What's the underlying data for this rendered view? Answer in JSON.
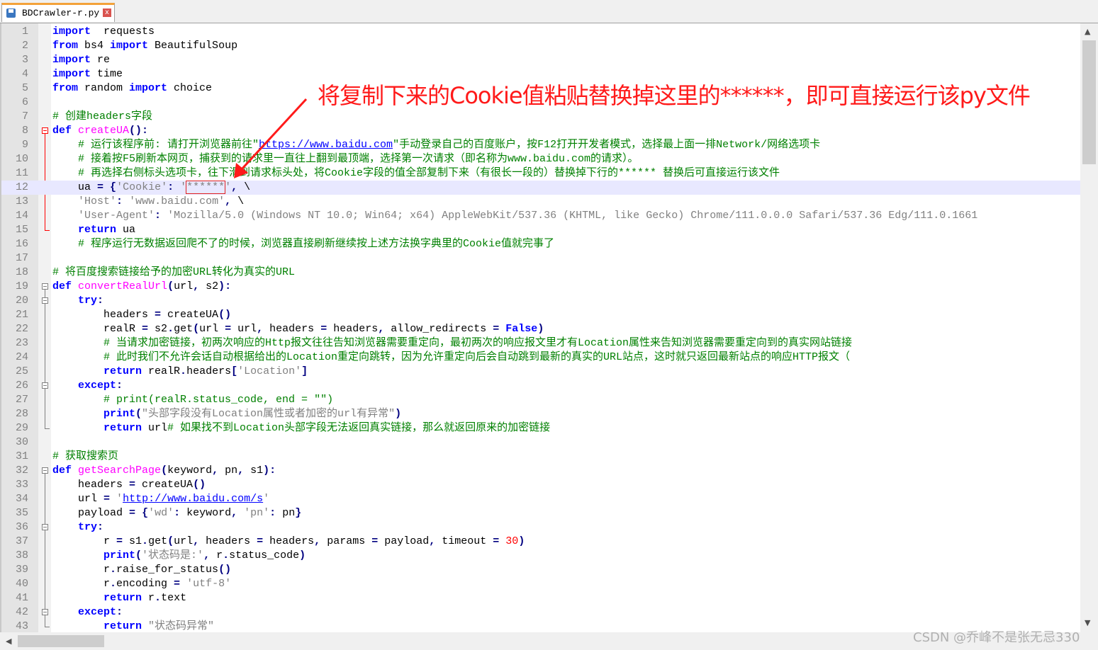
{
  "tab": {
    "filename": "BDCrawler-r.py",
    "close_glyph": "x",
    "icon": "save-icon"
  },
  "annotation": "将复制下来的Cookie值粘贴替换掉这里的******，即可直接运行该py文件",
  "watermark": "CSDN @乔峰不是张无忌330",
  "scrollbars": {
    "up_glyph": "▲",
    "down_glyph": "▼",
    "left_glyph": "◀"
  },
  "lines": [
    {
      "n": "1",
      "segs": [
        [
          "kw",
          "import"
        ],
        [
          "",
          "  requests"
        ]
      ]
    },
    {
      "n": "2",
      "segs": [
        [
          "kw",
          "from"
        ],
        [
          "",
          " bs4 "
        ],
        [
          "kw",
          "import"
        ],
        [
          "",
          " BeautifulSoup"
        ]
      ]
    },
    {
      "n": "3",
      "segs": [
        [
          "kw",
          "import"
        ],
        [
          "",
          " re"
        ]
      ]
    },
    {
      "n": "4",
      "segs": [
        [
          "kw",
          "import"
        ],
        [
          "",
          " time"
        ]
      ]
    },
    {
      "n": "5",
      "segs": [
        [
          "kw",
          "from"
        ],
        [
          "",
          " random "
        ],
        [
          "kw",
          "import"
        ],
        [
          "",
          " choice"
        ]
      ]
    },
    {
      "n": "6",
      "segs": []
    },
    {
      "n": "7",
      "segs": [
        [
          "cm",
          "# 创建headers字段"
        ]
      ]
    },
    {
      "n": "8",
      "segs": [
        [
          "kw",
          "def"
        ],
        [
          "",
          " "
        ],
        [
          "fn",
          "createUA"
        ],
        [
          "op",
          "():"
        ]
      ]
    },
    {
      "n": "9",
      "segs": [
        [
          "",
          "    "
        ],
        [
          "cm",
          "# 运行该程序前: 请打开浏览器前往\""
        ],
        [
          "cm lk",
          "https://www.baidu.com"
        ],
        [
          "cm",
          "\"手动登录自己的百度账户，按F12打开开发者模式，选择最上面一排Network/网络选项卡"
        ]
      ]
    },
    {
      "n": "10",
      "segs": [
        [
          "",
          "    "
        ],
        [
          "cm",
          "# 接着按F5刷新本网页，捕获到的请求里一直往上翻到最顶端，选择第一次请求（即名称为www.baidu.com的请求）。"
        ]
      ]
    },
    {
      "n": "11",
      "segs": [
        [
          "",
          "    "
        ],
        [
          "cm",
          "# 再选择右侧标头选项卡，往下滑到请求标头处，将Cookie字段的值全部复制下来（有很长一段的）替换掉下行的****** 替换后可直接运行该文件"
        ]
      ]
    },
    {
      "n": "12",
      "segs": [
        [
          "",
          "    ua "
        ],
        [
          "op",
          "="
        ],
        [
          "",
          " "
        ],
        [
          "op",
          "{"
        ],
        [
          "st",
          "'Cookie'"
        ],
        [
          "op",
          ":"
        ],
        [
          "",
          " "
        ],
        [
          "st",
          "'"
        ],
        [
          "st redbox",
          "******"
        ],
        [
          "st",
          "'"
        ],
        [
          "op",
          ","
        ],
        [
          "",
          " \\"
        ]
      ]
    },
    {
      "n": "13",
      "segs": [
        [
          "",
          "    "
        ],
        [
          "st",
          "'Host'"
        ],
        [
          "op",
          ":"
        ],
        [
          "",
          " "
        ],
        [
          "st",
          "'www.baidu.com'"
        ],
        [
          "op",
          ","
        ],
        [
          "",
          " \\"
        ]
      ]
    },
    {
      "n": "14",
      "segs": [
        [
          "",
          "    "
        ],
        [
          "st",
          "'User-Agent'"
        ],
        [
          "op",
          ":"
        ],
        [
          "",
          " "
        ],
        [
          "st",
          "'Mozilla/5.0 (Windows NT 10.0; Win64; x64) AppleWebKit/537.36 (KHTML, like Gecko) Chrome/111.0.0.0 Safari/537.36 Edg/111.0.1661"
        ]
      ]
    },
    {
      "n": "15",
      "segs": [
        [
          "",
          "    "
        ],
        [
          "kw",
          "return"
        ],
        [
          "",
          " ua"
        ]
      ]
    },
    {
      "n": "16",
      "segs": [
        [
          "",
          "    "
        ],
        [
          "cm",
          "# 程序运行无数据返回爬不了的时候，浏览器直接刷新继续按上述方法换字典里的Cookie值就完事了"
        ]
      ]
    },
    {
      "n": "17",
      "segs": []
    },
    {
      "n": "18",
      "segs": [
        [
          "cm",
          "# 将百度搜索链接给予的加密URL转化为真实的URL"
        ]
      ]
    },
    {
      "n": "19",
      "segs": [
        [
          "kw",
          "def"
        ],
        [
          "",
          " "
        ],
        [
          "fn",
          "convertRealUrl"
        ],
        [
          "op",
          "("
        ],
        [
          "",
          "url"
        ],
        [
          "op",
          ","
        ],
        [
          "",
          " s2"
        ],
        [
          "op",
          "):"
        ]
      ]
    },
    {
      "n": "20",
      "segs": [
        [
          "",
          "    "
        ],
        [
          "kw",
          "try"
        ],
        [
          "op",
          ":"
        ]
      ]
    },
    {
      "n": "21",
      "segs": [
        [
          "",
          "        headers "
        ],
        [
          "op",
          "="
        ],
        [
          "",
          " createUA"
        ],
        [
          "op",
          "()"
        ]
      ]
    },
    {
      "n": "22",
      "segs": [
        [
          "",
          "        realR "
        ],
        [
          "op",
          "="
        ],
        [
          "",
          " s2"
        ],
        [
          "op",
          "."
        ],
        [
          "",
          "get"
        ],
        [
          "op",
          "("
        ],
        [
          "",
          "url "
        ],
        [
          "op",
          "="
        ],
        [
          "",
          " url"
        ],
        [
          "op",
          ","
        ],
        [
          "",
          " headers "
        ],
        [
          "op",
          "="
        ],
        [
          "",
          " headers"
        ],
        [
          "op",
          ","
        ],
        [
          "",
          " allow_redirects "
        ],
        [
          "op",
          "="
        ],
        [
          "",
          " "
        ],
        [
          "kw",
          "False"
        ],
        [
          "op",
          ")"
        ]
      ]
    },
    {
      "n": "23",
      "segs": [
        [
          "",
          "        "
        ],
        [
          "cm",
          "# 当请求加密链接，初两次响应的Http报文往往告知浏览器需要重定向，最初两次的响应报文里才有Location属性来告知浏览器需要重定向到的真实网站链接"
        ]
      ]
    },
    {
      "n": "24",
      "segs": [
        [
          "",
          "        "
        ],
        [
          "cm",
          "# 此时我们不允许会话自动根据给出的Location重定向跳转，因为允许重定向后会自动跳到最新的真实的URL站点，这时就只返回最新站点的响应HTTP报文（"
        ]
      ]
    },
    {
      "n": "25",
      "segs": [
        [
          "",
          "        "
        ],
        [
          "kw",
          "return"
        ],
        [
          "",
          " realR"
        ],
        [
          "op",
          "."
        ],
        [
          "",
          "headers"
        ],
        [
          "op",
          "["
        ],
        [
          "st",
          "'Location'"
        ],
        [
          "op",
          "]"
        ]
      ]
    },
    {
      "n": "26",
      "segs": [
        [
          "",
          "    "
        ],
        [
          "kw",
          "except"
        ],
        [
          "op",
          ":"
        ]
      ]
    },
    {
      "n": "27",
      "segs": [
        [
          "",
          "        "
        ],
        [
          "cm",
          "# print(realR.status_code, end = \"\")"
        ]
      ]
    },
    {
      "n": "28",
      "segs": [
        [
          "",
          "        "
        ],
        [
          "kw",
          "print"
        ],
        [
          "op",
          "("
        ],
        [
          "st",
          "\"头部字段没有Location属性或者加密的url有异常\""
        ],
        [
          "op",
          ")"
        ]
      ]
    },
    {
      "n": "29",
      "segs": [
        [
          "",
          "        "
        ],
        [
          "kw",
          "return"
        ],
        [
          "",
          " url"
        ],
        [
          "cm",
          "# 如果找不到Location头部字段无法返回真实链接，那么就返回原来的加密链接"
        ]
      ]
    },
    {
      "n": "30",
      "segs": []
    },
    {
      "n": "31",
      "segs": [
        [
          "cm",
          "# 获取搜索页"
        ]
      ]
    },
    {
      "n": "32",
      "segs": [
        [
          "kw",
          "def"
        ],
        [
          "",
          " "
        ],
        [
          "fn",
          "getSearchPage"
        ],
        [
          "op",
          "("
        ],
        [
          "",
          "keyword"
        ],
        [
          "op",
          ","
        ],
        [
          "",
          " pn"
        ],
        [
          "op",
          ","
        ],
        [
          "",
          " s1"
        ],
        [
          "op",
          "):"
        ]
      ]
    },
    {
      "n": "33",
      "segs": [
        [
          "",
          "    headers "
        ],
        [
          "op",
          "="
        ],
        [
          "",
          " createUA"
        ],
        [
          "op",
          "()"
        ]
      ]
    },
    {
      "n": "34",
      "segs": [
        [
          "",
          "    url "
        ],
        [
          "op",
          "="
        ],
        [
          "",
          " "
        ],
        [
          "st",
          "'"
        ],
        [
          "st lk",
          "http://www.baidu.com/s"
        ],
        [
          "st",
          "'"
        ]
      ]
    },
    {
      "n": "35",
      "segs": [
        [
          "",
          "    payload "
        ],
        [
          "op",
          "="
        ],
        [
          "",
          " "
        ],
        [
          "op",
          "{"
        ],
        [
          "st",
          "'wd'"
        ],
        [
          "op",
          ":"
        ],
        [
          "",
          " keyword"
        ],
        [
          "op",
          ","
        ],
        [
          "",
          " "
        ],
        [
          "st",
          "'pn'"
        ],
        [
          "op",
          ":"
        ],
        [
          "",
          " pn"
        ],
        [
          "op",
          "}"
        ]
      ]
    },
    {
      "n": "36",
      "segs": [
        [
          "",
          "    "
        ],
        [
          "kw",
          "try"
        ],
        [
          "op",
          ":"
        ]
      ]
    },
    {
      "n": "37",
      "segs": [
        [
          "",
          "        r "
        ],
        [
          "op",
          "="
        ],
        [
          "",
          " s1"
        ],
        [
          "op",
          "."
        ],
        [
          "",
          "get"
        ],
        [
          "op",
          "("
        ],
        [
          "",
          "url"
        ],
        [
          "op",
          ","
        ],
        [
          "",
          " headers "
        ],
        [
          "op",
          "="
        ],
        [
          "",
          " headers"
        ],
        [
          "op",
          ","
        ],
        [
          "",
          " params "
        ],
        [
          "op",
          "="
        ],
        [
          "",
          " payload"
        ],
        [
          "op",
          ","
        ],
        [
          "",
          " timeout "
        ],
        [
          "op",
          "="
        ],
        [
          "",
          " "
        ],
        [
          "nm",
          "30"
        ],
        [
          "op",
          ")"
        ]
      ]
    },
    {
      "n": "38",
      "segs": [
        [
          "",
          "        "
        ],
        [
          "kw",
          "print"
        ],
        [
          "op",
          "("
        ],
        [
          "st",
          "'状态码是:'"
        ],
        [
          "op",
          ","
        ],
        [
          "",
          " r"
        ],
        [
          "op",
          "."
        ],
        [
          "",
          "status_code"
        ],
        [
          "op",
          ")"
        ]
      ]
    },
    {
      "n": "39",
      "segs": [
        [
          "",
          "        r"
        ],
        [
          "op",
          "."
        ],
        [
          "",
          "raise_for_status"
        ],
        [
          "op",
          "()"
        ]
      ]
    },
    {
      "n": "40",
      "segs": [
        [
          "",
          "        r"
        ],
        [
          "op",
          "."
        ],
        [
          "",
          "encoding "
        ],
        [
          "op",
          "="
        ],
        [
          "",
          " "
        ],
        [
          "st",
          "'utf-8'"
        ]
      ]
    },
    {
      "n": "41",
      "segs": [
        [
          "",
          "        "
        ],
        [
          "kw",
          "return"
        ],
        [
          "",
          " r"
        ],
        [
          "op",
          "."
        ],
        [
          "",
          "text"
        ]
      ]
    },
    {
      "n": "42",
      "segs": [
        [
          "",
          "    "
        ],
        [
          "kw",
          "except"
        ],
        [
          "op",
          ":"
        ]
      ]
    },
    {
      "n": "43",
      "segs": [
        [
          "",
          "        "
        ],
        [
          "kw",
          "return"
        ],
        [
          "",
          " "
        ],
        [
          "st",
          "\"状态码异常\""
        ]
      ]
    }
  ]
}
